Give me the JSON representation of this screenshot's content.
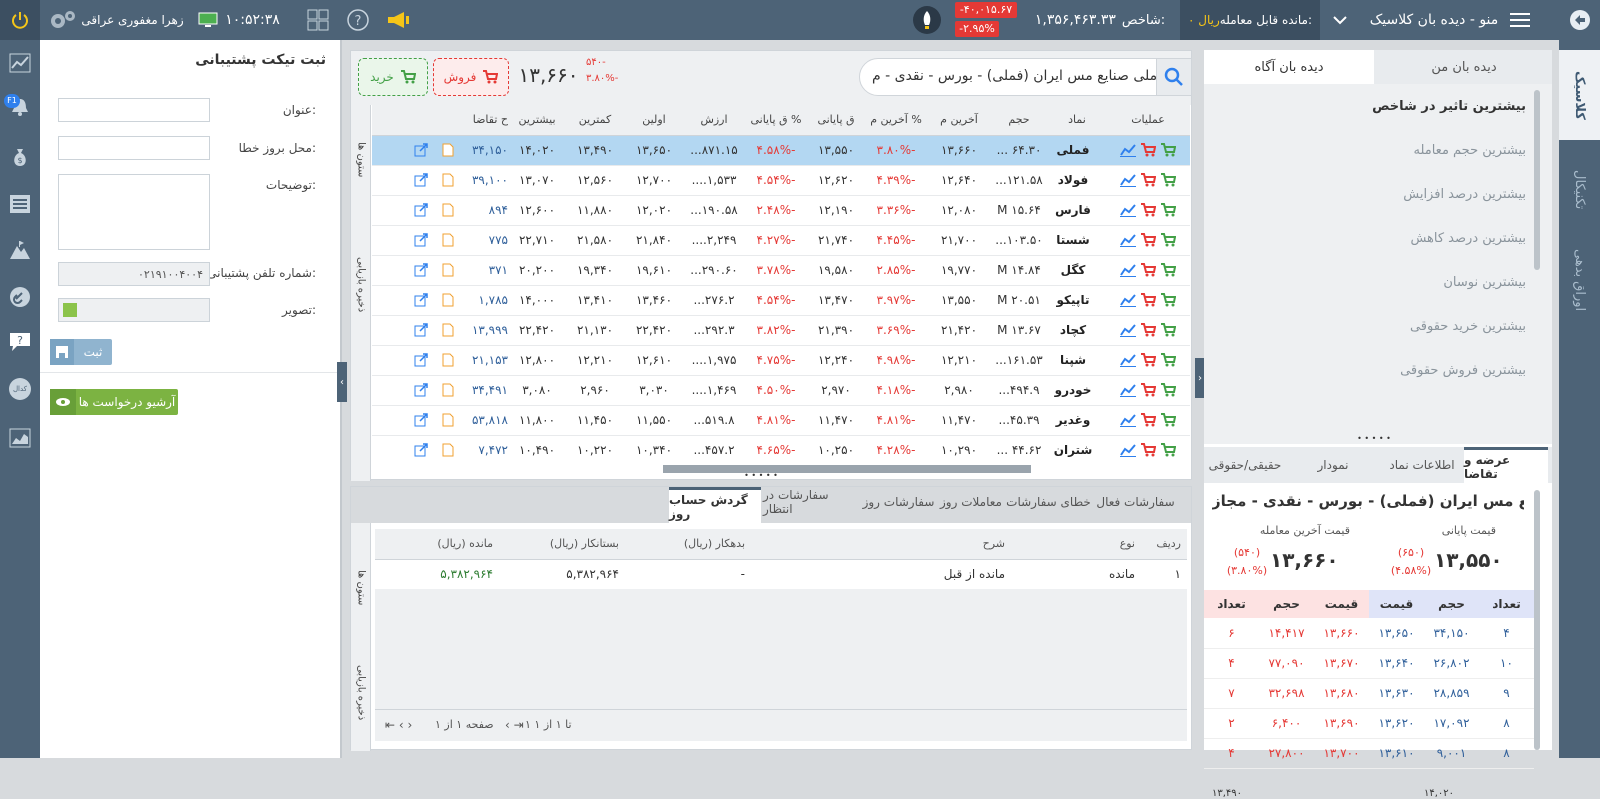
{
  "topbar": {
    "app_title": "منو - دیده بان کلاسیک",
    "balance_label": "مانده قابل معامله:",
    "balance_value": "۰ ریال",
    "index_label": "شاخص:",
    "index_value": "۱,۳۵۶,۴۶۳.۳۳",
    "index_change": "-۴۰,۰۱۵.۶۷",
    "index_change_pct": "-۲.۹۵%",
    "clock": "۱۰:۵۲:۳۸",
    "user_name": "زهرا مغفوری عراقی",
    "colors": {
      "bar": "#4d6377",
      "negative_badge": "#e53935",
      "accent_yellow": "#f5c518"
    }
  },
  "right_rail": {
    "tabs": [
      "کلاسیک",
      "تکنیکال",
      "اوراق بدهی"
    ]
  },
  "left_rail": {
    "icons": [
      "chart-line-icon",
      "bell-icon",
      "money-bag-icon",
      "list-icon",
      "mountain-icon",
      "link-icon",
      "question-chat-icon",
      "kodal-icon",
      "chart-area-icon"
    ],
    "kodal_label": "کدال",
    "notif_badge": "F1"
  },
  "support_ticket": {
    "title": "ثبت تیکت پشتیبانی",
    "label_subject": "عنوان:",
    "label_error_location": "محل بروز خطا:",
    "label_description": "توضیحات:",
    "label_phone": "شماره تلفن پشتیبانی:",
    "phone_value": "۰۲۱۹۱۰۰۴۰۰۴",
    "label_image": "تصویر:",
    "submit_label": "ثبت",
    "archive_label": "آرشیو درخواست ها"
  },
  "symbol_header": {
    "search_value": "ملی صنایع مس ایران (فملی) - بورس - نقدی - م",
    "price": "۱۳,۶۶۰",
    "change": "۵۴۰-",
    "change_pct": "۳.۸۰%-",
    "sell_label": "فروش",
    "buy_label": "خرید"
  },
  "watch_table": {
    "side_labels": [
      "ستون ها",
      "ذخیره بازیابی"
    ],
    "columns": [
      "عملیات",
      "نماد",
      "حجم",
      "آخرین م",
      "% آخرین م",
      "ق پایانی",
      "% ق پایانی",
      "ارزش",
      "اولین",
      "کمترین",
      "بیشترین",
      "ح تقاضا"
    ],
    "rows": [
      {
        "symbol": "فملی",
        "volume": "۶۴.۳۰ ...",
        "last": "۱۳,۶۶۰",
        "last_pct": "-۳.۸۰%",
        "close": "۱۳,۵۵۰",
        "close_pct": "-۴.۵۸%",
        "value": "۸۷۱.۱۵...",
        "first": "۱۳,۶۵۰",
        "low": "۱۳,۴۹۰",
        "high": "۱۴,۰۲۰",
        "bid": "۳۴,۱۵۰"
      },
      {
        "symbol": "فولاد",
        "volume": "۱۲۱.۵۸...",
        "last": "۱۲,۶۴۰",
        "last_pct": "-۴.۳۹%",
        "close": "۱۲,۶۲۰",
        "close_pct": "-۴.۵۴%",
        "value": "۱,۵۳۳....",
        "first": "۱۲,۷۰۰",
        "low": "۱۲,۵۶۰",
        "high": "۱۳,۰۷۰",
        "bid": "۳۹,۱۰۰"
      },
      {
        "symbol": "فارس",
        "volume": "۱۵.۶۴ M",
        "last": "۱۲,۰۸۰",
        "last_pct": "-۳.۳۶%",
        "close": "۱۲,۱۹۰",
        "close_pct": "-۲.۴۸%",
        "value": "۱۹۰.۵۸...",
        "first": "۱۲,۰۲۰",
        "low": "۱۱,۸۸۰",
        "high": "۱۲,۶۰۰",
        "bid": "۸۹۴"
      },
      {
        "symbol": "شستا",
        "volume": "۱۰۳.۵۰...",
        "last": "۲۱,۷۰۰",
        "last_pct": "-۴.۴۵%",
        "close": "۲۱,۷۴۰",
        "close_pct": "-۴.۲۷%",
        "value": "۲,۲۴۹....",
        "first": "۲۱,۸۴۰",
        "low": "۲۱,۵۸۰",
        "high": "۲۲,۷۱۰",
        "bid": "۷۷۵"
      },
      {
        "symbol": "کگل",
        "volume": "۱۴.۸۴ M",
        "last": "۱۹,۷۷۰",
        "last_pct": "-۲.۸۵%",
        "close": "۱۹,۵۸۰",
        "close_pct": "-۳.۷۸%",
        "value": "۲۹۰.۶۰...",
        "first": "۱۹,۶۱۰",
        "low": "۱۹,۳۴۰",
        "high": "۲۰,۲۰۰",
        "bid": "۳۷۱"
      },
      {
        "symbol": "تاپیکو",
        "volume": "۲۰.۵۱ M",
        "last": "۱۳,۵۵۰",
        "last_pct": "-۳.۹۷%",
        "close": "۱۳,۴۷۰",
        "close_pct": "-۴.۵۴%",
        "value": "۲۷۶.۲...",
        "first": "۱۳,۴۶۰",
        "low": "۱۳,۴۱۰",
        "high": "۱۴,۰۰۰",
        "bid": "۱,۷۸۵"
      },
      {
        "symbol": "کچاد",
        "volume": "۱۳.۶۷ M",
        "last": "۲۱,۴۲۰",
        "last_pct": "-۳.۶۹%",
        "close": "۲۱,۳۹۰",
        "close_pct": "-۳.۸۲%",
        "value": "۲۹۲.۳...",
        "first": "۲۲,۴۲۰",
        "low": "۲۱,۱۳۰",
        "high": "۲۲,۴۲۰",
        "bid": "۱۳,۹۹۹"
      },
      {
        "symbol": "شپنا",
        "volume": "۱۶۱.۵۳...",
        "last": "۱۲,۲۱۰",
        "last_pct": "-۴.۹۸%",
        "close": "۱۲,۲۴۰",
        "close_pct": "-۴.۷۵%",
        "value": "۱,۹۷۵....",
        "first": "۱۲,۶۱۰",
        "low": "۱۲,۲۱۰",
        "high": "۱۲,۸۰۰",
        "bid": "۲۱,۱۵۳"
      },
      {
        "symbol": "خودرو",
        "volume": "۴۹۴.۹...",
        "last": "۲,۹۸۰",
        "last_pct": "-۴.۱۸%",
        "close": "۲,۹۷۰",
        "close_pct": "-۴.۵۰%",
        "value": "۱,۴۶۹....",
        "first": "۳,۰۳۰",
        "low": "۲,۹۶۰",
        "high": "۳,۰۸۰",
        "bid": "۳۴,۴۹۱"
      },
      {
        "symbol": "وغدیر",
        "volume": "۴۵.۳۹...",
        "last": "۱۱,۴۷۰",
        "last_pct": "-۴.۸۱%",
        "close": "۱۱,۴۷۰",
        "close_pct": "-۴.۸۱%",
        "value": "۵۱۹.۸...",
        "first": "۱۱,۵۵۰",
        "low": "۱۱,۴۵۰",
        "high": "۱۱,۸۰۰",
        "bid": "۵۳,۸۱۸"
      },
      {
        "symbol": "شتران",
        "volume": "۴۴.۶۲ ...",
        "last": "۱۰,۲۹۰",
        "last_pct": "-۴.۲۸%",
        "close": "۱۰,۲۵۰",
        "close_pct": "-۴.۶۵%",
        "value": "۴۵۷.۲...",
        "first": "۱۰,۳۴۰",
        "low": "۱۰,۲۲۰",
        "high": "۱۰,۴۹۰",
        "bid": "۷,۴۷۲"
      }
    ]
  },
  "bottom": {
    "tabs": [
      "سفارشات فعال",
      "خطای سفارشات",
      "معاملات روز",
      "سفارشات روز",
      "سفارشات در انتظار",
      "گردش حساب روز"
    ],
    "active_tab": "گردش حساب روز",
    "side_labels": [
      "ستون ها",
      "ذخیره بازیابی"
    ],
    "columns": [
      "ردیف",
      "نوع",
      "شرح",
      "بدهکار (ریال)",
      "بستانکار (ریال)",
      "مانده (ریال)"
    ],
    "rows": [
      {
        "index": "۱",
        "type": "مانده",
        "desc": "مانده از قبل",
        "debit": "-",
        "credit": "۵,۳۸۲,۹۶۴",
        "balance": "۵,۳۸۲,۹۶۴"
      }
    ],
    "pager_range": "۱ تا ۱ از ۱",
    "pager_page": "صفحه ۱ از ۱"
  },
  "watch_sidebar": {
    "tabs": [
      "دیده بان من",
      "دیده بان آگاه"
    ],
    "active_tab": "دیده بان آگاه",
    "items": [
      "بیشترین تاثیر در شاخص",
      "بیشترین حجم معامله",
      "بیشترین درصد افزایش",
      "بیشترین درصد کاهش",
      "بیشترین نوسان",
      "بیشترین خرید حقوقی",
      "بیشترین فروش حقوقی"
    ]
  },
  "symbol_info": {
    "tabs": [
      "عرضه و تقاضا",
      "اطلاعات نماد",
      "نمودار",
      "حقیقی/حقوقی"
    ],
    "active_tab": "عرضه و تقاضا",
    "name": "ملی صنایع مس ایران (فملی) - بورس - نقدی - مجاز",
    "close_label": "قیمت پایانی",
    "close_value": "۱۳,۵۵۰",
    "close_change": "(۶۵۰)",
    "close_change_pct": "(۴.۵۸%)",
    "last_label": "قیمت آخرین معامله",
    "last_value": "۱۳,۶۶۰",
    "last_change": "(۵۴۰)",
    "last_change_pct": "(۳.۸۰%)",
    "orderbook_columns": [
      "تعداد",
      "حجم",
      "قیمت",
      "قیمت",
      "حجم",
      "تعداد"
    ],
    "orderbook": [
      {
        "buy_count": "۴",
        "buy_vol": "۳۴,۱۵۰",
        "buy_price": "۱۳,۶۵۰",
        "sell_price": "۱۳,۶۶۰",
        "sell_vol": "۱۴,۴۱۷",
        "sell_count": "۶"
      },
      {
        "buy_count": "۱۰",
        "buy_vol": "۲۶,۸۰۲",
        "buy_price": "۱۳,۶۴۰",
        "sell_price": "۱۳,۶۷۰",
        "sell_vol": "۷۷,۰۹۰",
        "sell_count": "۴"
      },
      {
        "buy_count": "۹",
        "buy_vol": "۲۸,۸۵۹",
        "buy_price": "۱۳,۶۳۰",
        "sell_price": "۱۳,۶۸۰",
        "sell_vol": "۳۲,۶۹۸",
        "sell_count": "۷"
      },
      {
        "buy_count": "۸",
        "buy_vol": "۱۷,۰۹۲",
        "buy_price": "۱۳,۶۲۰",
        "sell_price": "۱۳,۶۹۰",
        "sell_vol": "۶,۴۰۰",
        "sell_count": "۲"
      },
      {
        "buy_count": "۸",
        "buy_vol": "۹,۰۰۱",
        "buy_price": "۱۳,۶۱۰",
        "sell_price": "۱۳,۷۰۰",
        "sell_vol": "۲۷,۸۰۰",
        "sell_count": "۴"
      }
    ],
    "range_low": "۱۳,۴۹۰",
    "range_high": "۱۴,۰۲۰"
  }
}
